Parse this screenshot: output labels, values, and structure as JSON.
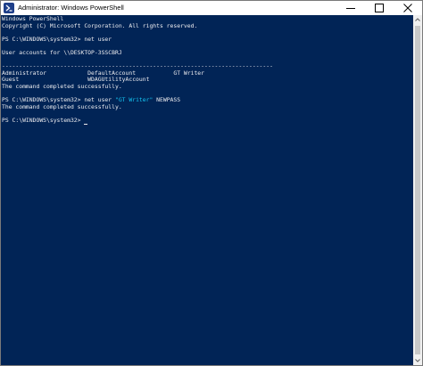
{
  "window": {
    "title": "Administrator: Windows PowerShell"
  },
  "console": {
    "header_line1": "Windows PowerShell",
    "header_line2": "Copyright (C) Microsoft Corporation. All rights reserved.",
    "prompt1": "PS C:\\WINDOWS\\system32> ",
    "command1": "net user",
    "accounts_line": "User accounts for \\\\DESKTOP-3SSCBRJ",
    "separator": "-------------------------------------------------------------------------------",
    "accounts_row1": "Administrator            DefaultAccount           GT Writer",
    "accounts_row2": "Guest                    WDAGUtilityAccount",
    "completed1": "The command completed successfully.",
    "prompt2": "PS C:\\WINDOWS\\system32> ",
    "command2_name": "net user ",
    "command2_arg": "\"GT Writer\"",
    "command2_rest": " NEWPASS",
    "completed2": "The command completed successfully.",
    "prompt3": "PS C:\\WINDOWS\\system32> "
  },
  "colors": {
    "console_background": "#012456",
    "console_text": "#eeedf0",
    "string_highlight": "#14c5f2"
  },
  "icons": {
    "app": "powershell-icon",
    "minimize": "minimize-icon",
    "maximize": "maximize-icon",
    "close": "close-icon"
  }
}
